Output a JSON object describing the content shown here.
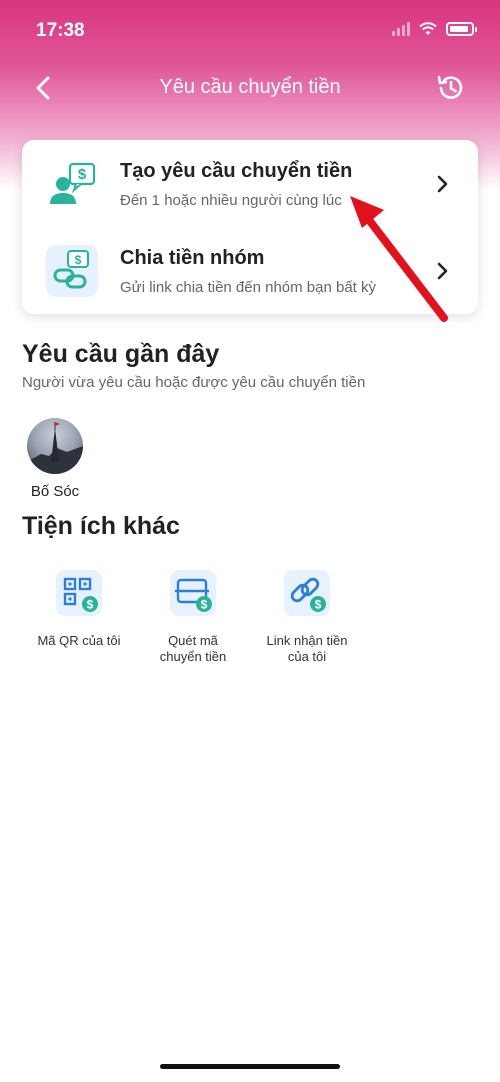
{
  "status_bar": {
    "time": "17:38"
  },
  "nav": {
    "title": "Yêu cầu chuyển tiền"
  },
  "options": [
    {
      "title": "Tạo yêu cầu chuyển tiền",
      "subtitle": "Đến 1 hoặc nhiều người cùng lúc"
    },
    {
      "title": "Chia tiền nhóm",
      "subtitle": "Gửi link chia tiền đến nhóm bạn bất kỳ"
    }
  ],
  "recent": {
    "title": "Yêu cầu gần đây",
    "subtitle": "Người vừa yêu cầu hoặc được yêu cầu chuyển tiền",
    "contacts": [
      {
        "name": "Bố Sóc"
      }
    ]
  },
  "utilities": {
    "title": "Tiện ích khác",
    "items": [
      {
        "label_line1": "Mã QR của tôi",
        "label_line2": ""
      },
      {
        "label_line1": "Quét mã",
        "label_line2": "chuyển tiền"
      },
      {
        "label_line1": "Link nhận tiền",
        "label_line2": "của tôi"
      }
    ]
  },
  "colors": {
    "brand_pink": "#d9347f",
    "accent_green": "#2bb39a",
    "accent_blue": "#2b7fd6",
    "annotation_red": "#e3111b"
  },
  "icons": [
    "back-icon",
    "history-icon",
    "request-money-icon",
    "split-bill-icon",
    "chevron-right-icon",
    "qr-code-icon",
    "scan-transfer-icon",
    "receive-link-icon"
  ]
}
